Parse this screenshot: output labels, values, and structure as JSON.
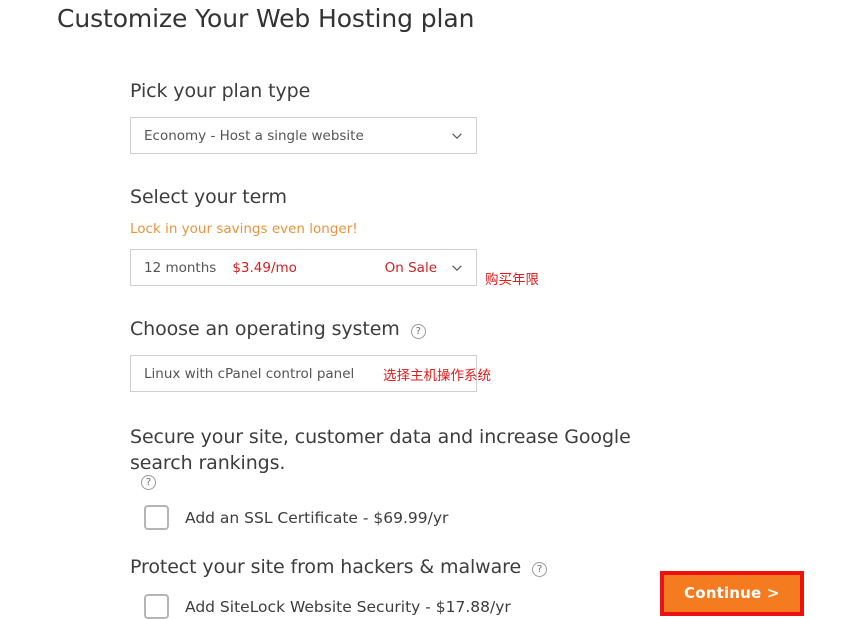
{
  "page": {
    "title": "Customize Your Web Hosting plan"
  },
  "sections": {
    "plan_type": {
      "heading": "Pick your plan type",
      "selected": "Economy - Host a single website",
      "chevron_icon": "chevron-down-icon"
    },
    "term": {
      "heading": "Select your term",
      "promo": "Lock in your savings even longer!",
      "duration": "12 months",
      "price": "$3.49/mo",
      "badge": "On Sale",
      "chevron_icon": "chevron-down-icon",
      "annotation": "购买年限"
    },
    "operating_system": {
      "heading": "Choose an operating system",
      "help_icon": "help-circle-icon",
      "selected": "Linux with cPanel control panel",
      "annotation": "选择主机操作系统"
    },
    "ssl": {
      "heading": "Secure your site, customer data and increase Google search rankings.",
      "help_icon": "help-circle-icon",
      "checkbox_label": "Add an SSL Certificate - $69.99/yr"
    },
    "sitelock": {
      "heading": "Protect your site from hackers & malware",
      "help_icon": "help-circle-icon",
      "checkbox_label": "Add SiteLock Website Security - $17.88/yr"
    }
  },
  "footer": {
    "continue_label": "Continue >"
  },
  "colors": {
    "accent_orange": "#f47b20",
    "promo_orange": "#e8943f",
    "sale_red": "#cc2222",
    "annotation_red": "#e01b1b",
    "highlight_red": "#ee1111",
    "field_border": "#cfcfcf"
  }
}
